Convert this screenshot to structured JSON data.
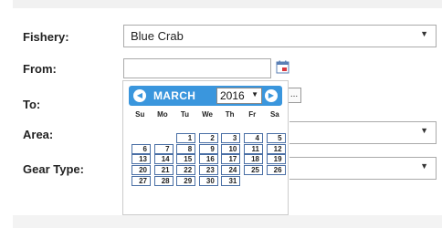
{
  "form": {
    "fishery_label": "Fishery:",
    "fishery_value": "Blue Crab",
    "from_label": "From:",
    "to_label": "To:",
    "area_label": "Area:",
    "gear_label": "Gear Type:"
  },
  "datepicker": {
    "month": "MARCH",
    "year": "2016",
    "more_label": "...",
    "dow": [
      "Su",
      "Mo",
      "Tu",
      "We",
      "Th",
      "Fr",
      "Sa"
    ],
    "weeks": [
      [
        "",
        "",
        "1",
        "2",
        "3",
        "4",
        "5"
      ],
      [
        "6",
        "7",
        "8",
        "9",
        "10",
        "11",
        "12"
      ],
      [
        "13",
        "14",
        "15",
        "16",
        "17",
        "18",
        "19"
      ],
      [
        "20",
        "21",
        "22",
        "23",
        "24",
        "25",
        "26"
      ],
      [
        "27",
        "28",
        "29",
        "30",
        "31",
        "",
        ""
      ]
    ]
  },
  "icons": {
    "caret": "▼",
    "prev": "◀",
    "next": "▶"
  },
  "colors": {
    "header_blue": "#3a96dd",
    "day_border": "#4a6fa5"
  }
}
